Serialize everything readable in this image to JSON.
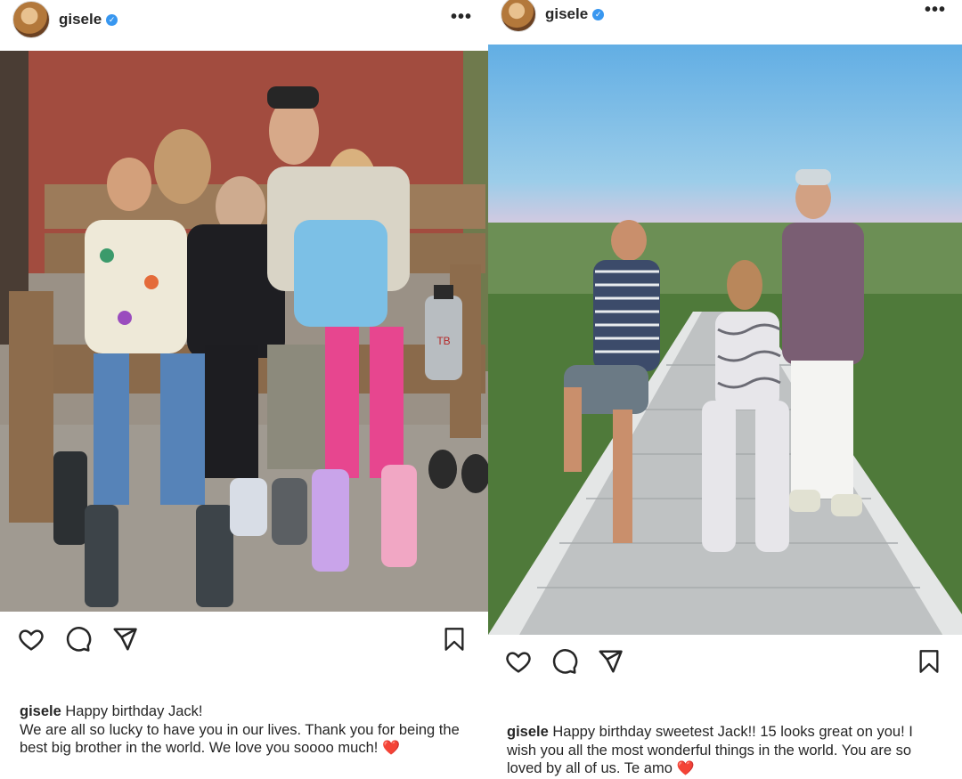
{
  "left_post": {
    "username": "gisele",
    "verified_badge": "✓",
    "more_icon": "•••",
    "photo_alt": "Family seated on a wooden bench in front of a red wall",
    "caption_user": "gisele",
    "caption_text": "Happy birthday Jack!",
    "caption_body": "We are all so lucky to have you in our lives. Thank you for being the best big brother in the world. We love you soooo much!",
    "emoji": "❤️"
  },
  "right_post": {
    "username": "gisele",
    "verified_badge": "✓",
    "more_icon": "•••",
    "photo_alt": "Three kids posing on a wooden boardwalk in grass at dusk",
    "caption_user": "gisele",
    "caption_text": "Happy birthday sweetest Jack!! 15 looks  great on you! I wish you all the most wonderful things in the world. You are so loved by all of us. Te amo",
    "emoji": "❤️"
  },
  "bottle_text": "TB"
}
